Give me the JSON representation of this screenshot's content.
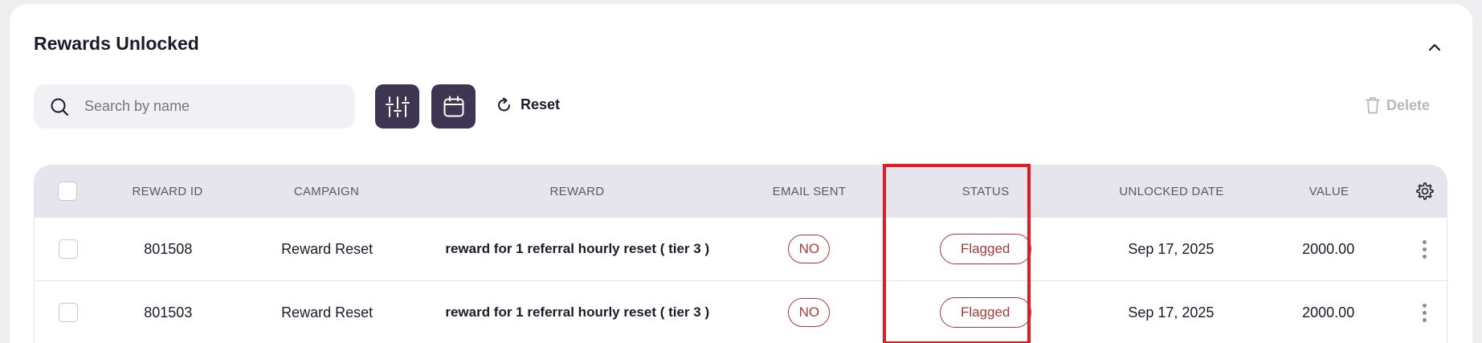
{
  "card": {
    "title": "Rewards Unlocked"
  },
  "toolbar": {
    "search_placeholder": "Search by name",
    "reset_label": "Reset",
    "delete_label": "Delete"
  },
  "table": {
    "headers": {
      "reward_id": "REWARD ID",
      "campaign": "CAMPAIGN",
      "reward": "REWARD",
      "email_sent": "EMAIL SENT",
      "status": "STATUS",
      "unlocked_date": "UNLOCKED DATE",
      "value": "VALUE"
    },
    "rows": [
      {
        "reward_id": "801508",
        "campaign": "Reward Reset",
        "reward": "reward for 1 referral hourly reset ( tier 3 )",
        "email_sent": "NO",
        "status": "Flagged",
        "unlocked_date": "Sep 17, 2025",
        "value": "2000.00"
      },
      {
        "reward_id": "801503",
        "campaign": "Reward Reset",
        "reward": "reward for 1 referral hourly reset ( tier 3 )",
        "email_sent": "NO",
        "status": "Flagged",
        "unlocked_date": "Sep 17, 2025",
        "value": "2000.00"
      }
    ]
  },
  "icons": {
    "collapse": "chevron-up-icon",
    "search": "search-icon",
    "filter": "sliders-icon",
    "calendar": "calendar-icon",
    "reset": "refresh-icon",
    "delete": "trash-icon",
    "settings": "gear-icon",
    "row_menu": "more-vertical-icon"
  },
  "colors": {
    "accent_dark": "#3d3551",
    "status_red": "#a63b3b",
    "highlight": "#e01b24",
    "header_bg": "#e6e4ec"
  }
}
